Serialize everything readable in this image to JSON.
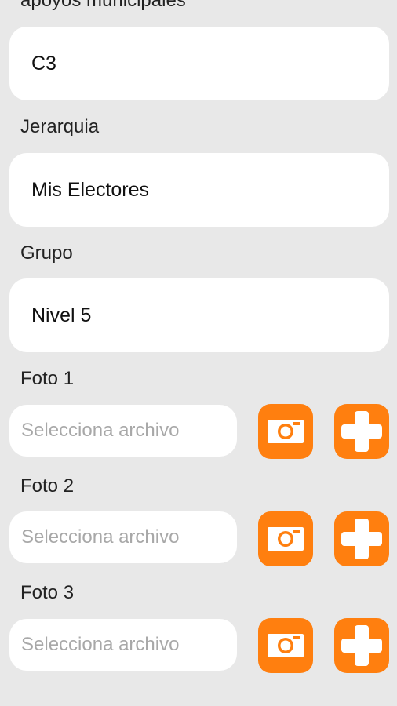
{
  "sections": {
    "apoyos_label": "apoyos municipales",
    "apoyos_value": "C3",
    "jerarquia_label": "Jerarquia",
    "jerarquia_value": "Mis Electores",
    "grupo_label": "Grupo",
    "grupo_value": "Nivel 5"
  },
  "photos": [
    {
      "label": "Foto 1",
      "placeholder": "Selecciona archivo"
    },
    {
      "label": "Foto 2",
      "placeholder": "Selecciona archivo"
    },
    {
      "label": "Foto 3",
      "placeholder": "Selecciona archivo"
    }
  ],
  "icons": {
    "camera": "camera-icon",
    "add": "plus-icon"
  },
  "colors": {
    "accent": "#ff7f0f",
    "background": "#e8e8e8",
    "field": "#ffffff",
    "placeholder": "#a8a8a8"
  }
}
